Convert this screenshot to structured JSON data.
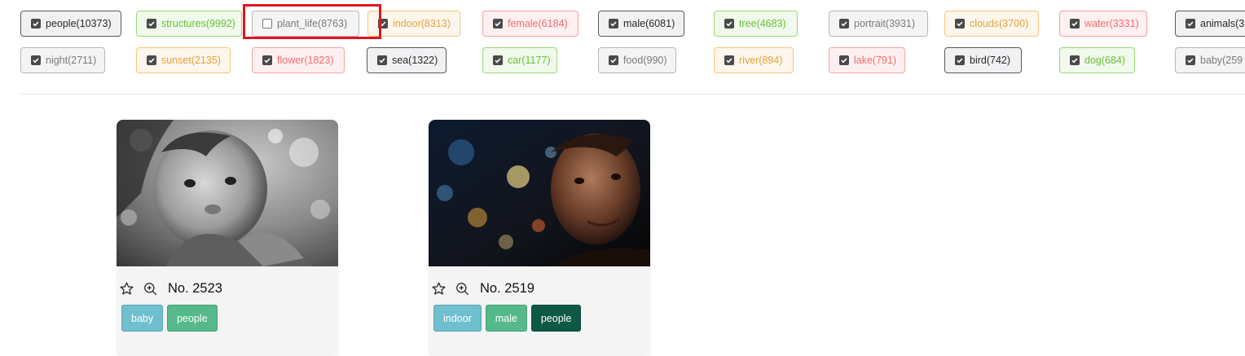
{
  "filters": {
    "row1": [
      {
        "label": "people(10373)",
        "checked": true,
        "style": "dark"
      },
      {
        "label": "structures(9992)",
        "checked": true,
        "style": "green"
      },
      {
        "label": "plant_life(8763)",
        "checked": false,
        "style": "gray-light"
      },
      {
        "label": "indoor(8313)",
        "checked": true,
        "style": "orange"
      },
      {
        "label": "female(6184)",
        "checked": true,
        "style": "red"
      },
      {
        "label": "male(6081)",
        "checked": true,
        "style": "dark"
      },
      {
        "label": "tree(4683)",
        "checked": true,
        "style": "green"
      },
      {
        "label": "portrait(3931)",
        "checked": true,
        "style": "gray-light"
      },
      {
        "label": "clouds(3700)",
        "checked": true,
        "style": "orange"
      },
      {
        "label": "water(3331)",
        "checked": true,
        "style": "red"
      },
      {
        "label": "animals(3",
        "checked": true,
        "style": "dark"
      }
    ],
    "row2": [
      {
        "label": "night(2711)",
        "checked": true,
        "style": "gray-light"
      },
      {
        "label": "sunset(2135)",
        "checked": true,
        "style": "orange"
      },
      {
        "label": "flower(1823)",
        "checked": true,
        "style": "red"
      },
      {
        "label": "sea(1322)",
        "checked": true,
        "style": "dark"
      },
      {
        "label": "car(1177)",
        "checked": true,
        "style": "green"
      },
      {
        "label": "food(990)",
        "checked": true,
        "style": "gray-light"
      },
      {
        "label": "river(894)",
        "checked": true,
        "style": "orange"
      },
      {
        "label": "lake(791)",
        "checked": true,
        "style": "red"
      },
      {
        "label": "bird(742)",
        "checked": true,
        "style": "dark"
      },
      {
        "label": "dog(684)",
        "checked": true,
        "style": "green"
      },
      {
        "label": "baby(259",
        "checked": true,
        "style": "gray-light"
      }
    ]
  },
  "cards": [
    {
      "number": "No. 2523",
      "photo": "grayscale-baby-portrait",
      "tags": [
        {
          "label": "baby",
          "style": "baby"
        },
        {
          "label": "people",
          "style": "people-mid"
        }
      ]
    },
    {
      "number": "No. 2519",
      "photo": "night-bokeh-man-portrait",
      "tags": [
        {
          "label": "indoor",
          "style": "indoor"
        },
        {
          "label": "male",
          "style": "male"
        },
        {
          "label": "people",
          "style": "people-dark"
        }
      ]
    }
  ],
  "icons": {
    "favorite": "star-outline-icon",
    "zoom": "zoom-in-icon",
    "checkbox": "check-icon"
  },
  "colors": {
    "highlight": "#e0141e",
    "green": "#67c23a",
    "orange": "#e6a23c",
    "red": "#f56c6c",
    "gray": "#8e8e93"
  }
}
